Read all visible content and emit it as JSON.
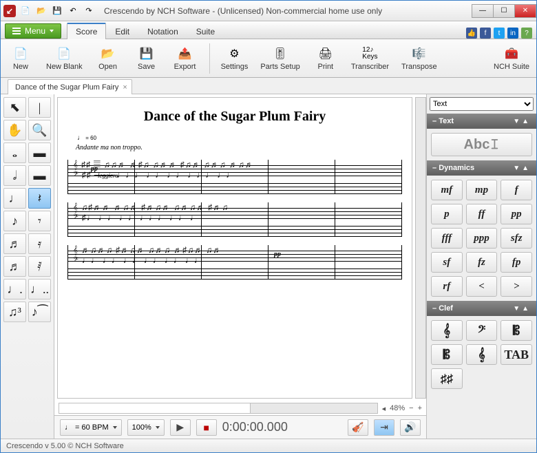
{
  "titlebar": {
    "app_glyph": "↙",
    "title": "Crescendo by NCH Software - (Unlicensed) Non-commercial home use only"
  },
  "menu_button_label": "Menu",
  "tabs": [
    "Score",
    "Edit",
    "Notation",
    "Suite"
  ],
  "active_tab_index": 0,
  "socials": [
    {
      "name": "like",
      "bg": "#3b5998",
      "glyph": "👍"
    },
    {
      "name": "facebook",
      "bg": "#3b5998",
      "glyph": "f"
    },
    {
      "name": "twitter",
      "bg": "#1da1f2",
      "glyph": "t"
    },
    {
      "name": "linkedin",
      "bg": "#0a66c2",
      "glyph": "in"
    },
    {
      "name": "help",
      "bg": "#6aa84f",
      "glyph": "?"
    }
  ],
  "ribbon": {
    "new": "New",
    "newblank": "New Blank",
    "open": "Open",
    "save": "Save",
    "export": "Export",
    "settings": "Settings",
    "parts": "Parts Setup",
    "print": "Print",
    "transcriber": "Transcriber",
    "transpose": "Transpose",
    "nchsuite": "NCH Suite"
  },
  "doc_tab": "Dance of the Sugar Plum Fairy",
  "score": {
    "title": "Dance of the Sugar Plum Fairy",
    "tempo_text": "Andante ma non troppo.",
    "dynamic_1": "pp",
    "expr_1": "leggiero",
    "dynamic_2": "pp"
  },
  "zoom_display": "48%",
  "transport": {
    "bpm_note": "♩",
    "bpm_text": "= 60 BPM",
    "zoom_box": "100%",
    "time": "0:00:00.000"
  },
  "rightpanel": {
    "dropdown_value": "Text",
    "sect_text": "Text",
    "text_btn": "Abc",
    "sect_dynamics": "Dynamics",
    "dyn": [
      "mf",
      "mp",
      "f",
      "p",
      "ff",
      "pp",
      "fff",
      "ppp",
      "sfz",
      "sf",
      "fz",
      "fp",
      "rf",
      "<",
      ">"
    ],
    "sect_clef": "Clef",
    "clefs": [
      "𝄞",
      "𝄢",
      "𝄡",
      "𝄡",
      "𝄞",
      "TAB",
      "♯♯"
    ]
  },
  "status": "Crescendo v 5.00   © NCH Software"
}
